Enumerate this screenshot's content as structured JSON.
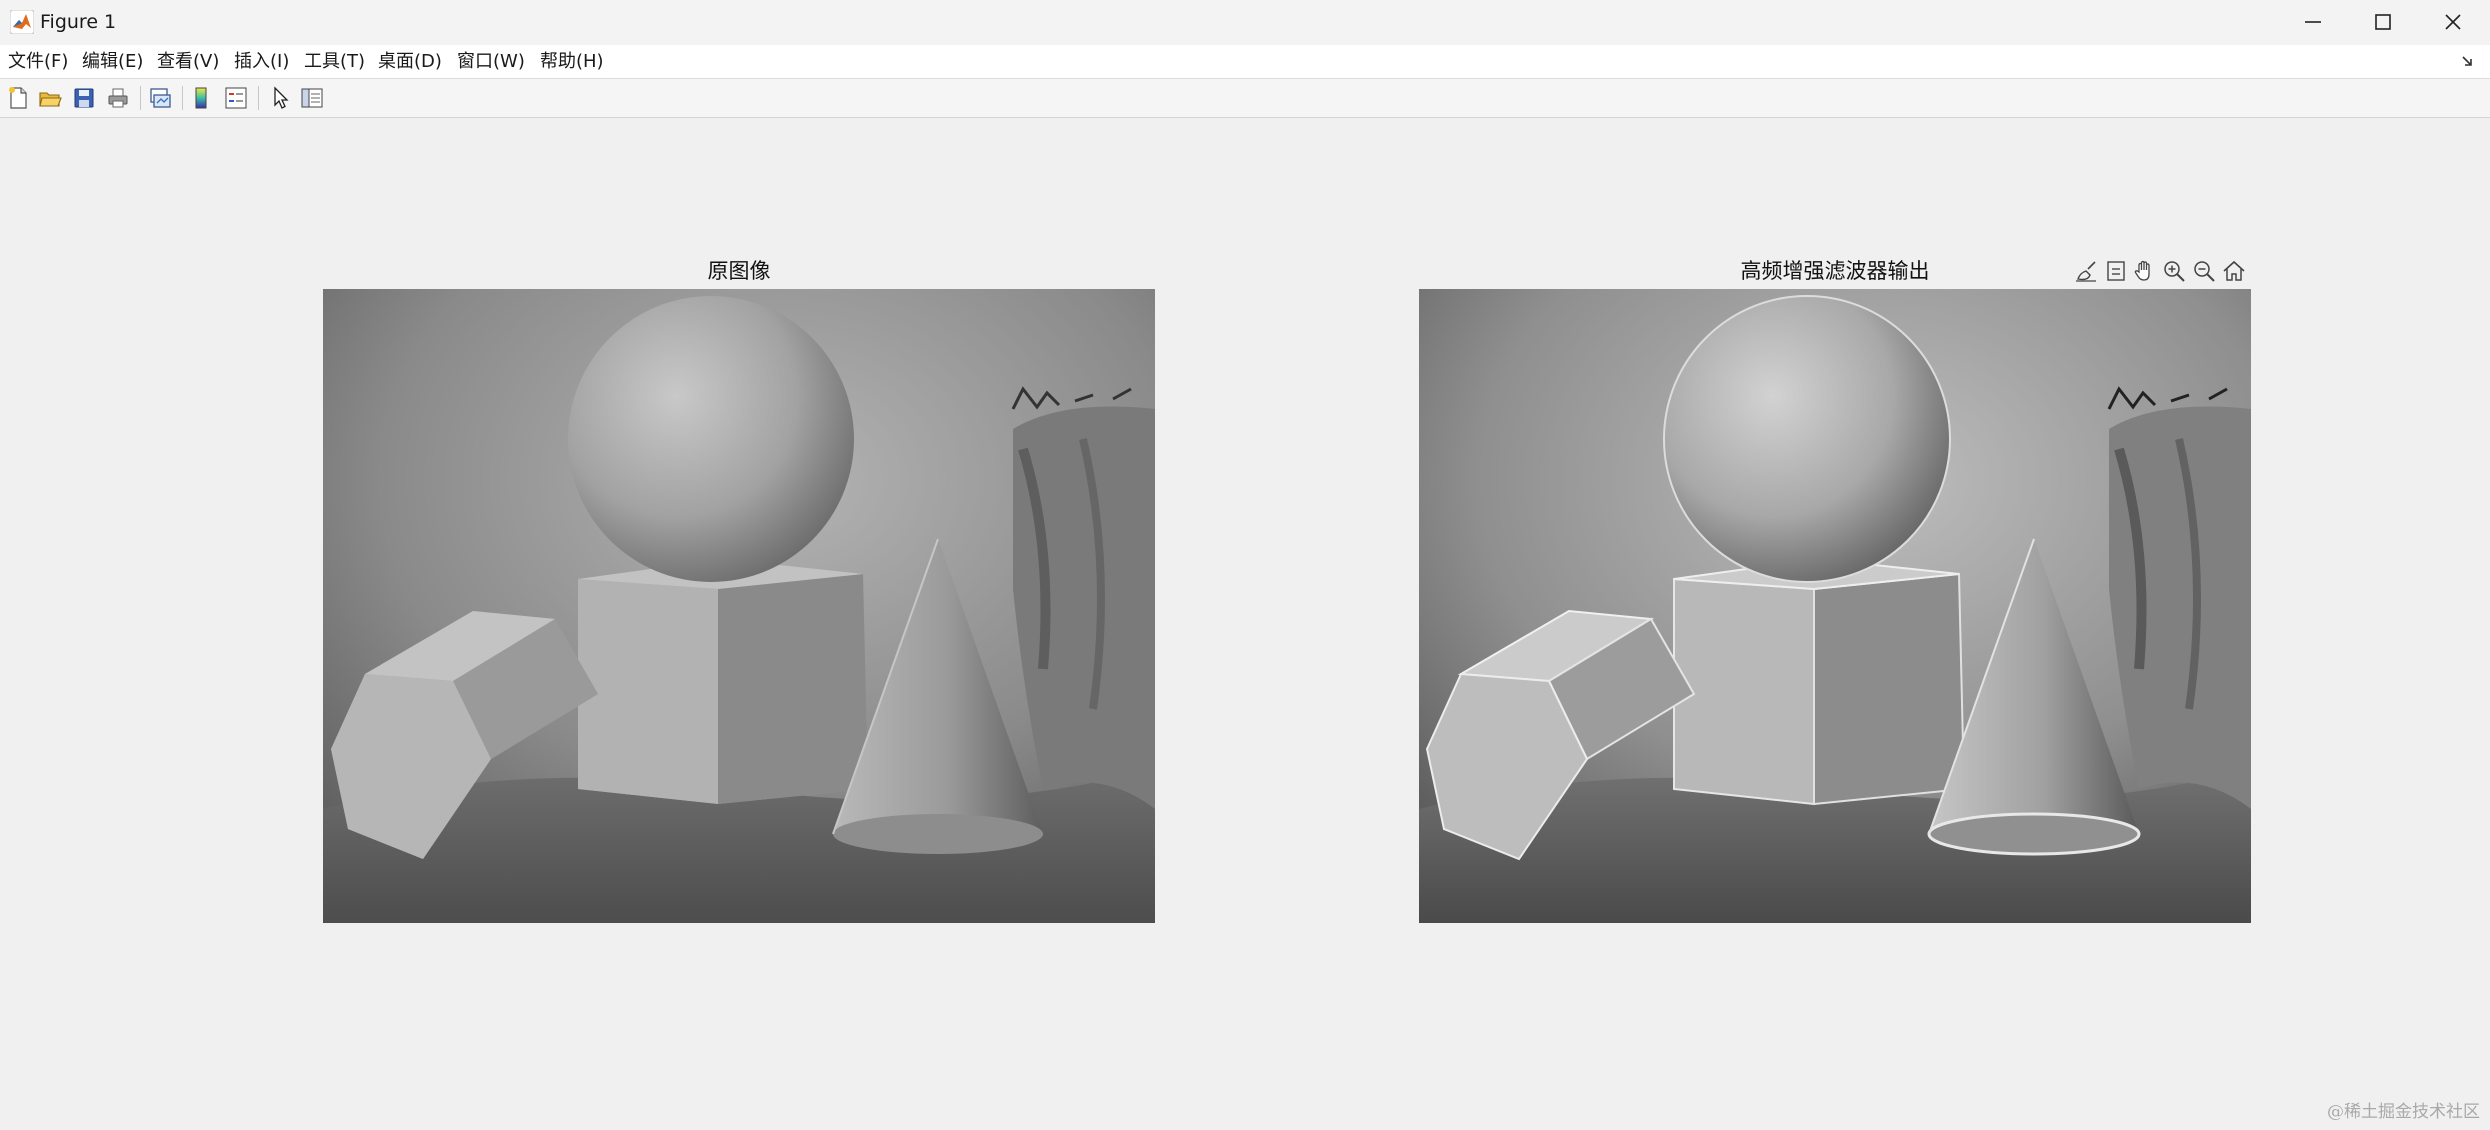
{
  "window": {
    "title": "Figure 1",
    "minimize_icon": "minimize-icon",
    "maximize_icon": "maximize-icon",
    "close_icon": "close-icon"
  },
  "menu": {
    "items": [
      {
        "label": "文件(F)"
      },
      {
        "label": "编辑(E)"
      },
      {
        "label": "查看(V)"
      },
      {
        "label": "插入(I)"
      },
      {
        "label": "工具(T)"
      },
      {
        "label": "桌面(D)"
      },
      {
        "label": "窗口(W)"
      },
      {
        "label": "帮助(H)"
      }
    ]
  },
  "toolbar": {
    "icons": [
      "new-figure-icon",
      "open-file-icon",
      "save-icon",
      "print-icon",
      "link-plot-icon",
      "colorbar-icon",
      "legend-icon",
      "edit-plot-arrow-icon",
      "property-inspector-icon"
    ]
  },
  "axes": [
    {
      "title": "原图像",
      "image": "still-life sketch: sphere, cube, hexagonal prism, cone, drapery"
    },
    {
      "title": "高频增强滤波器输出",
      "image": "edge-enhanced still-life sketch: sphere, cube, hexagonal prism, cone, drapery"
    }
  ],
  "axes_toolbar": {
    "icons": [
      "brush-icon",
      "datatip-icon",
      "pan-hand-icon",
      "zoom-in-icon",
      "zoom-out-icon",
      "home-icon"
    ]
  },
  "watermark": "@稀土掘金技术社区",
  "colors": {
    "background": "#f0f0f0",
    "menubar": "#ffffff",
    "matlab_orange": "#e16a1c"
  }
}
